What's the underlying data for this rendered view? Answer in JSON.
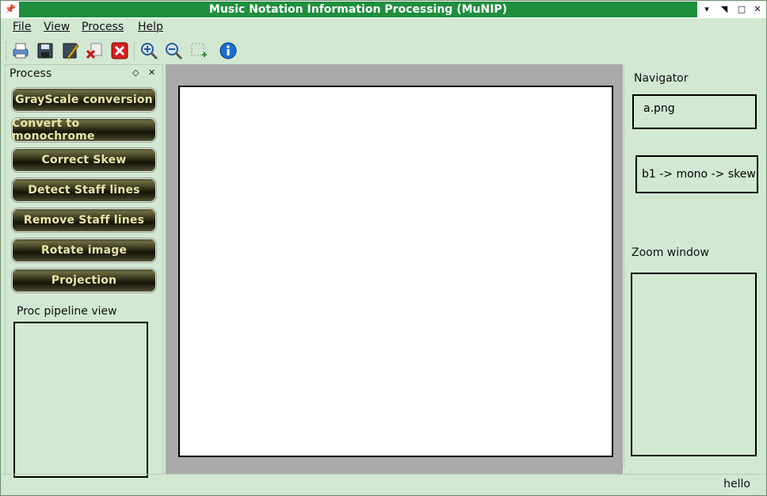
{
  "window": {
    "title": "Music Notation Information Processing (MuNIP)"
  },
  "menu": [
    "File",
    "View",
    "Process",
    "Help"
  ],
  "toolbar": {
    "icons": [
      "printer-icon",
      "save-icon",
      "edit-icon",
      "delete-icon",
      "close-red-icon",
      "zoom-in-icon",
      "zoom-out-icon",
      "select-region-icon",
      "info-icon"
    ]
  },
  "process_panel": {
    "title": "Process",
    "buttons": [
      "GrayScale conversion",
      "Convert to monochrome",
      "Correct Skew",
      "Detect Staff lines",
      "Remove Staff lines",
      "Rotate image",
      "Projection"
    ],
    "pipeline_label": "Proc pipeline view"
  },
  "navigator": {
    "title": "Navigator",
    "file": "a.png",
    "pipeline": "b1 -> mono -> skew",
    "zoom_label": "Zoom window"
  },
  "status": {
    "text": "hello"
  }
}
